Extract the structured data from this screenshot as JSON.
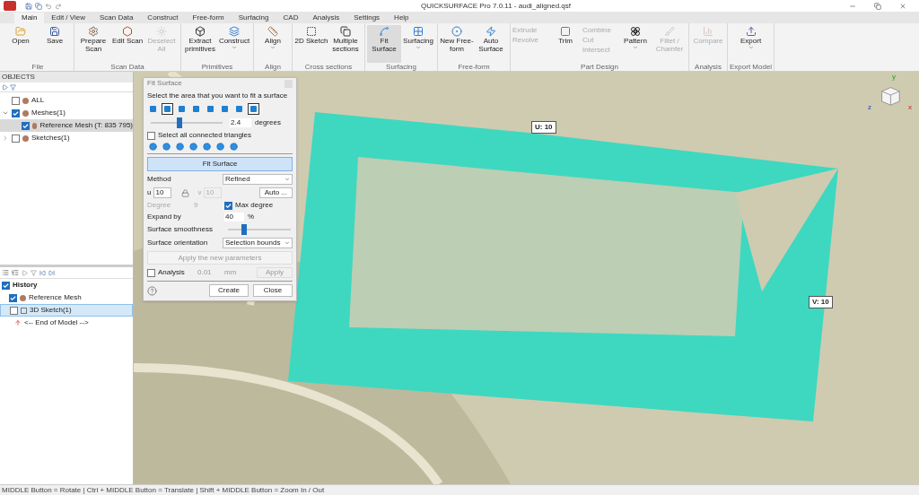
{
  "window": {
    "title": "QUICKSURFACE Pro 7.0.11 - audi_aligned.qsf"
  },
  "menu_tabs": [
    {
      "label": "Main",
      "selected": true
    },
    {
      "label": "Edit / View",
      "selected": false
    },
    {
      "label": "Scan Data",
      "selected": false
    },
    {
      "label": "Construct",
      "selected": false
    },
    {
      "label": "Free-form",
      "selected": false
    },
    {
      "label": "Surfacing",
      "selected": false
    },
    {
      "label": "CAD",
      "selected": false
    },
    {
      "label": "Analysis",
      "selected": false
    },
    {
      "label": "Settings",
      "selected": false
    },
    {
      "label": "Help",
      "selected": false
    }
  ],
  "ribbon_groups": [
    {
      "label": "File",
      "items": [
        {
          "kind": "large",
          "label": "Open",
          "disabled": false,
          "selected": false,
          "dropdown": false
        },
        {
          "kind": "large",
          "label": "Save",
          "disabled": false,
          "selected": false,
          "dropdown": false
        }
      ]
    },
    {
      "label": "Scan Data",
      "items": [
        {
          "kind": "large",
          "label": "Prepare Scan",
          "disabled": false,
          "selected": false,
          "dropdown": false
        },
        {
          "kind": "large",
          "label": "Edit Scan",
          "disabled": false,
          "selected": false,
          "dropdown": false
        },
        {
          "kind": "large",
          "label": "Deselect All",
          "disabled": true,
          "selected": false,
          "dropdown": false
        }
      ]
    },
    {
      "label": "Primitives",
      "items": [
        {
          "kind": "large",
          "label": "Extract primitives",
          "disabled": false,
          "selected": false,
          "dropdown": false
        },
        {
          "kind": "large",
          "label": "Construct",
          "disabled": false,
          "selected": false,
          "dropdown": true
        }
      ]
    },
    {
      "label": "Align",
      "items": [
        {
          "kind": "large",
          "label": "Align",
          "disabled": false,
          "selected": false,
          "dropdown": true
        }
      ]
    },
    {
      "label": "Cross sections",
      "items": [
        {
          "kind": "large",
          "label": "2D Sketch",
          "disabled": false,
          "selected": false,
          "dropdown": false
        },
        {
          "kind": "large",
          "label": "Multiple sections",
          "disabled": false,
          "selected": false,
          "dropdown": false
        }
      ]
    },
    {
      "label": "Surfacing",
      "items": [
        {
          "kind": "large",
          "label": "Fit Surface",
          "disabled": false,
          "selected": true,
          "dropdown": false
        },
        {
          "kind": "large",
          "label": "Surfacing",
          "disabled": false,
          "selected": false,
          "dropdown": true
        }
      ]
    },
    {
      "label": "Free-form",
      "items": [
        {
          "kind": "large",
          "label": "New Free-form",
          "disabled": false,
          "selected": false,
          "dropdown": false
        },
        {
          "kind": "large",
          "label": "Auto Surface",
          "disabled": false,
          "selected": false,
          "dropdown": false
        }
      ]
    },
    {
      "label": "Part Design",
      "items": [
        {
          "kind": "stack",
          "items": [
            {
              "label": "Extrude",
              "disabled": true
            },
            {
              "label": "Revolve",
              "disabled": true
            }
          ]
        },
        {
          "kind": "large",
          "label": "Trim",
          "disabled": false,
          "selected": false,
          "dropdown": false
        },
        {
          "kind": "stack",
          "items": [
            {
              "label": "Combine",
              "disabled": true
            },
            {
              "label": "Cut",
              "disabled": true
            },
            {
              "label": "Intersect",
              "disabled": true
            }
          ]
        },
        {
          "kind": "large",
          "label": "Pattern",
          "disabled": false,
          "selected": false,
          "dropdown": true
        },
        {
          "kind": "large",
          "label": "Fillet / Chamfer",
          "disabled": true,
          "selected": false,
          "dropdown": false
        }
      ]
    },
    {
      "label": "Analysis",
      "items": [
        {
          "kind": "large",
          "label": "Compare",
          "disabled": true,
          "selected": false,
          "dropdown": false
        }
      ]
    },
    {
      "label": "Export Model",
      "items": [
        {
          "kind": "large",
          "label": "Export",
          "disabled": false,
          "selected": false,
          "dropdown": true
        }
      ]
    }
  ],
  "objects_panel": {
    "title": "OBJECTS",
    "tree": [
      {
        "label": "ALL",
        "checked": false,
        "selected": false
      },
      {
        "label": "Meshes(1)",
        "checked": true,
        "selected": false,
        "expanded": true,
        "children": [
          {
            "label": "Reference Mesh (T: 835 795)",
            "checked": true,
            "selected": true
          }
        ]
      },
      {
        "label": "Sketches(1)",
        "checked": false,
        "selected": false,
        "expanded": false
      }
    ]
  },
  "history_panel": {
    "items": [
      {
        "kind": "root",
        "label": "History",
        "checked": true,
        "selected": false
      },
      {
        "kind": "mesh",
        "label": "Reference Mesh",
        "checked": true,
        "selected": false
      },
      {
        "kind": "sketch",
        "label": "3D Sketch(1)",
        "checked": false,
        "selected": true
      },
      {
        "kind": "end",
        "label": "<-- End of Model -->"
      }
    ]
  },
  "dialog": {
    "title": "Fit Surface",
    "prompt": "Select the area that you want to fit a surface",
    "selection_tools": [
      {
        "selected": false
      },
      {
        "selected": true
      },
      {
        "selected": false
      },
      {
        "selected": false
      },
      {
        "selected": false
      },
      {
        "selected": false
      },
      {
        "selected": false
      },
      {
        "selected": true
      }
    ],
    "angle": {
      "level": 0.4,
      "value": "2.4",
      "unit": "degrees"
    },
    "connected": {
      "label": "Select all connected triangles",
      "checked": false
    },
    "fit_button": "Fit Surface",
    "method": {
      "label": "Method",
      "value": "Refined"
    },
    "u": {
      "label": "u",
      "value": "10"
    },
    "v": {
      "label": "v",
      "value": "10",
      "disabled": true
    },
    "auto_button": "Auto ...",
    "degree": {
      "label": "Degree",
      "value": "9",
      "disabled": true
    },
    "max_degree": {
      "label": "Max degree",
      "checked": true
    },
    "expand": {
      "label": "Expand by",
      "value": "40",
      "unit": "%"
    },
    "smoothness": {
      "label": "Surface smoothness",
      "level": 0.25
    },
    "orientation": {
      "label": "Surface orientation",
      "value": "Selection bounds"
    },
    "apply_params": {
      "label": "Apply the new parameters",
      "disabled": true
    },
    "analysis": {
      "label": "Analysis",
      "checked": false,
      "value": "0.01",
      "unit": "mm",
      "apply": "Apply",
      "disabled": true
    },
    "buttons": [
      "Create",
      "Close"
    ]
  },
  "viewport": {
    "u_label": "U: 10",
    "v_label": "V: 10",
    "axes": [
      "y",
      "x",
      "z"
    ]
  },
  "status_bar": "MIDDLE Button = Rotate | Ctrl + MIDDLE Button = Translate | Shift + MIDDLE Button = Zoom In / Out"
}
